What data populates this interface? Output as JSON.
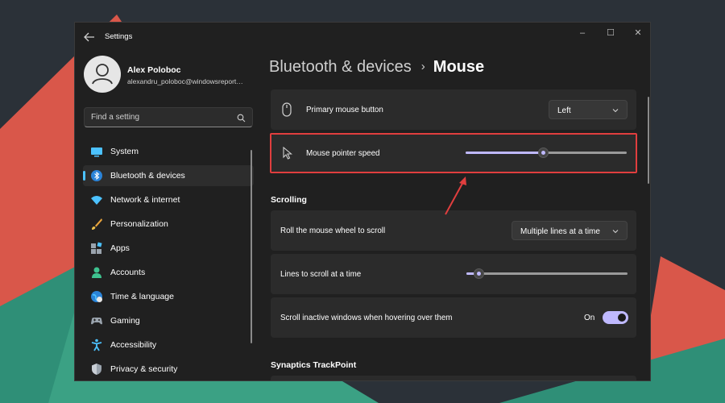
{
  "window": {
    "title": "Settings",
    "controls": [
      "minimize-icon",
      "maximize-icon",
      "close-icon"
    ]
  },
  "user": {
    "name": "Alex Poloboc",
    "email": "alexandru_poloboc@windowsreport…"
  },
  "search": {
    "placeholder": "Find a setting"
  },
  "nav": {
    "items": [
      {
        "label": "System",
        "icon": "system-icon"
      },
      {
        "label": "Bluetooth & devices",
        "icon": "bluetooth-icon",
        "active": true
      },
      {
        "label": "Network & internet",
        "icon": "network-icon"
      },
      {
        "label": "Personalization",
        "icon": "brush-icon"
      },
      {
        "label": "Apps",
        "icon": "apps-icon"
      },
      {
        "label": "Accounts",
        "icon": "accounts-icon"
      },
      {
        "label": "Time & language",
        "icon": "globe-icon"
      },
      {
        "label": "Gaming",
        "icon": "gamepad-icon"
      },
      {
        "label": "Accessibility",
        "icon": "accessibility-icon"
      },
      {
        "label": "Privacy & security",
        "icon": "shield-icon"
      }
    ]
  },
  "breadcrumb": {
    "parent": "Bluetooth & devices",
    "separator": "›",
    "current": "Mouse"
  },
  "settings": {
    "primary_button": {
      "label": "Primary mouse button",
      "value": "Left"
    },
    "pointer_speed": {
      "label": "Mouse pointer speed",
      "level": 0.48
    },
    "scrolling_title": "Scrolling",
    "roll_wheel": {
      "label": "Roll the mouse wheel to scroll",
      "value": "Multiple lines at a time"
    },
    "lines_to_scroll": {
      "label": "Lines to scroll at a time",
      "level": 0.05
    },
    "scroll_inactive": {
      "label": "Scroll inactive windows when hovering over them",
      "state": "On"
    },
    "trackpoint_title": "Synaptics TrackPoint"
  },
  "colors": {
    "accent": "#bfb9ff",
    "highlight": "#e03e3e",
    "active_indicator": "#4cc2ff"
  }
}
